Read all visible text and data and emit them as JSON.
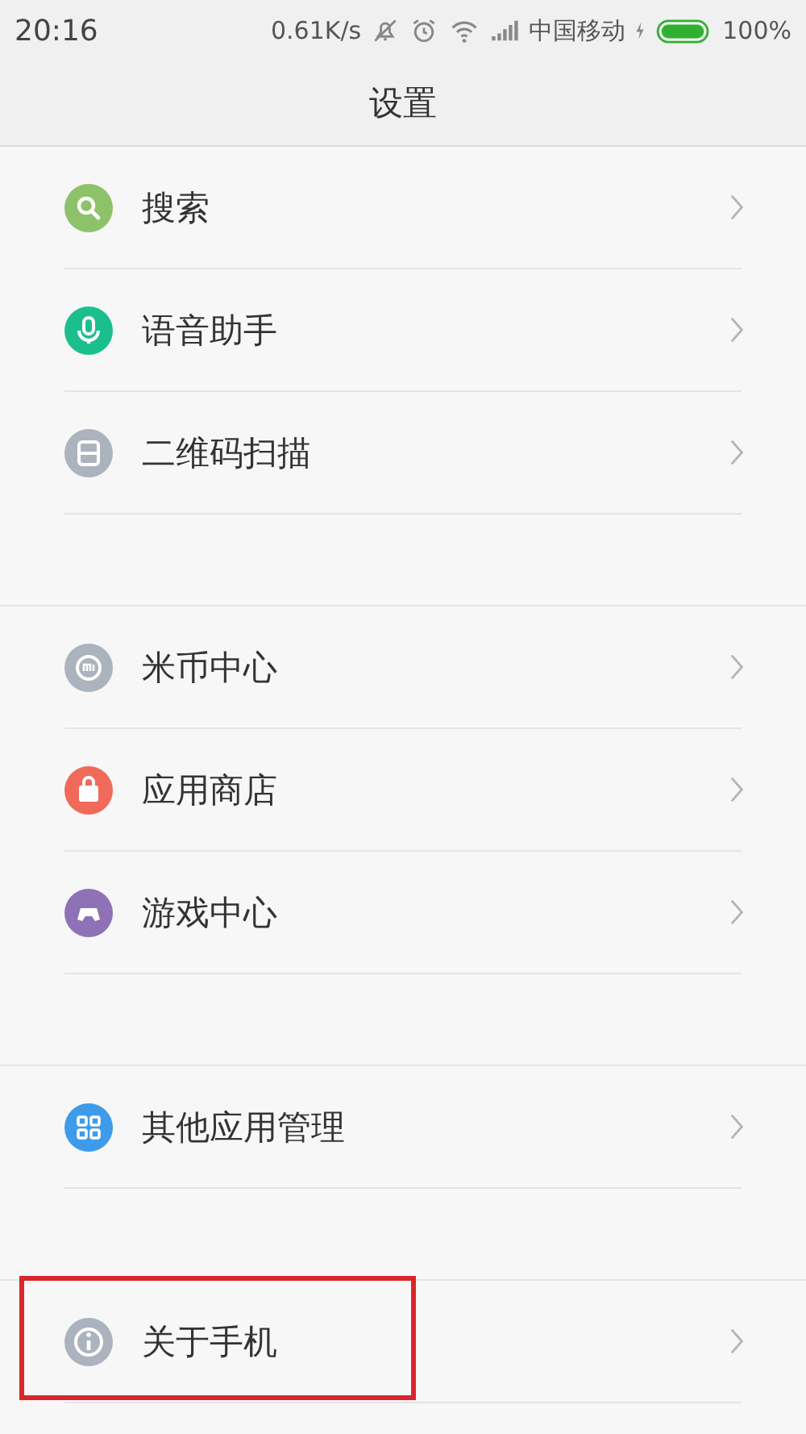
{
  "status_bar": {
    "time": "20:16",
    "speed": "0.61K/s",
    "carrier": "中国移动",
    "battery": "100%"
  },
  "title_bar": {
    "title": "设置"
  },
  "groups": [
    {
      "items": [
        {
          "label": "搜索",
          "kind": "search",
          "color": "#8dc26a",
          "highlighted": false
        },
        {
          "label": "语音助手",
          "kind": "mic",
          "color": "#1bbf8e",
          "highlighted": false
        },
        {
          "label": "二维码扫描",
          "kind": "scan",
          "color": "#aab3be",
          "highlighted": false
        }
      ]
    },
    {
      "items": [
        {
          "label": "米币中心",
          "kind": "coin",
          "color": "#aab3be",
          "highlighted": false
        },
        {
          "label": "应用商店",
          "kind": "bag",
          "color": "#f06a5a",
          "highlighted": false
        },
        {
          "label": "游戏中心",
          "kind": "gamepad",
          "color": "#8e72b5",
          "highlighted": false
        }
      ]
    },
    {
      "items": [
        {
          "label": "其他应用管理",
          "kind": "grid",
          "color": "#3d9be9",
          "highlighted": false
        }
      ]
    },
    {
      "items": [
        {
          "label": "关于手机",
          "kind": "info",
          "color": "#aab3be",
          "highlighted": true
        }
      ]
    }
  ]
}
